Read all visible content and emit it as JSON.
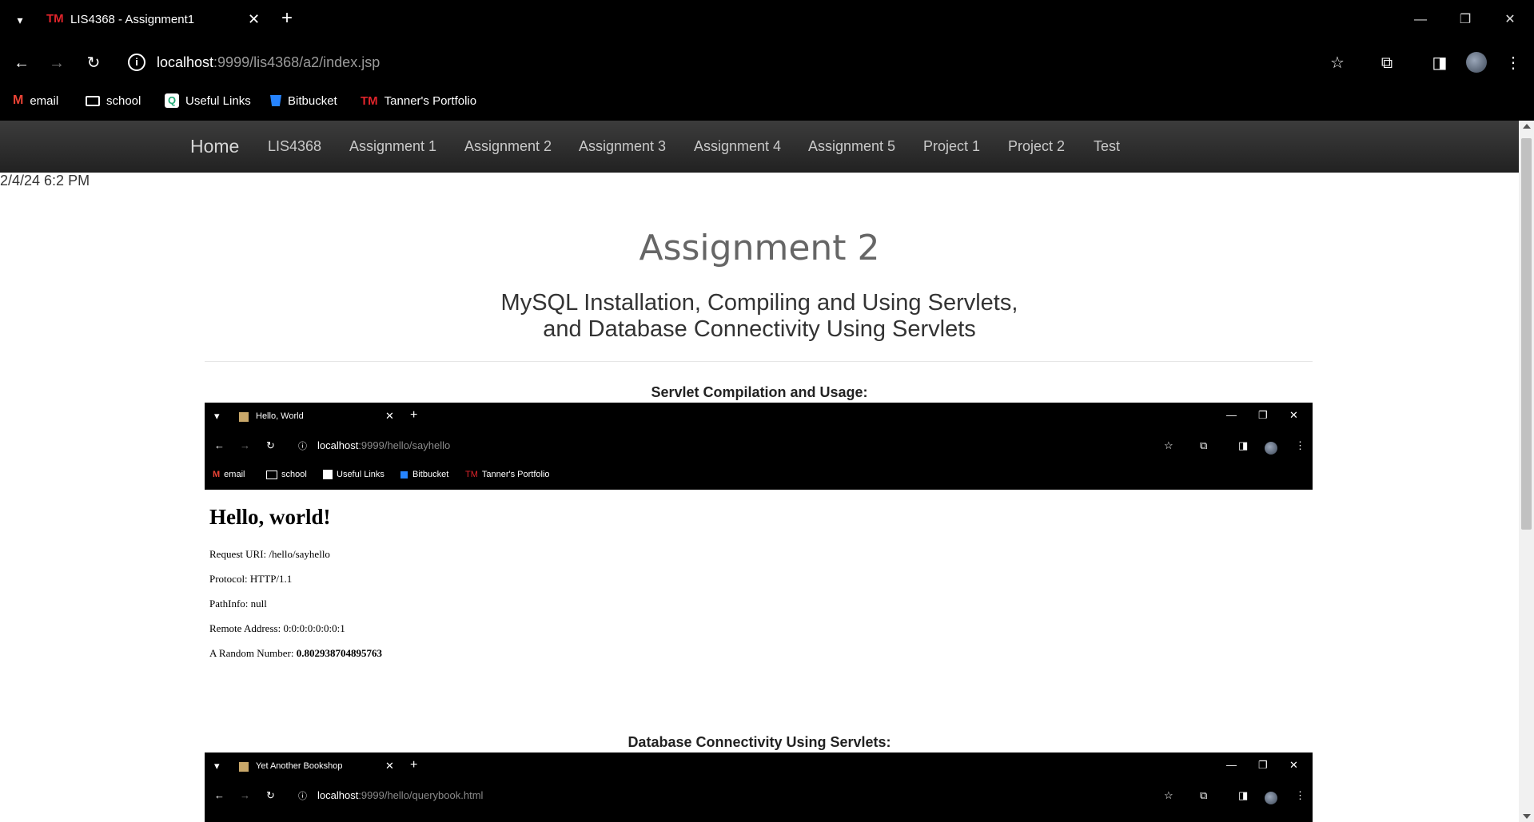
{
  "browser": {
    "tab": {
      "favicon_text": "TM",
      "title": "LIS4368 - Assignment1"
    },
    "url_host": "localhost",
    "url_rest": ":9999/lis4368/a2/index.jsp",
    "bookmarks": [
      {
        "icon": "gmail-icon",
        "label": "email"
      },
      {
        "icon": "folder-icon",
        "label": "school"
      },
      {
        "icon": "quick-links-icon",
        "label": "Useful Links"
      },
      {
        "icon": "bitbucket-icon",
        "label": "Bitbucket"
      },
      {
        "icon": "tm-logo-icon",
        "icon_text": "TM",
        "label": "Tanner's Portfolio"
      }
    ]
  },
  "navbar": {
    "brand": "Home",
    "items": [
      "LIS4368",
      "Assignment 1",
      "Assignment 2",
      "Assignment 3",
      "Assignment 4",
      "Assignment 5",
      "Project 1",
      "Project 2",
      "Test"
    ]
  },
  "page": {
    "timestamp": "2/4/24 6:2 PM",
    "title": "Assignment 2",
    "subtitle_line1": "MySQL Installation, Compiling and Using Servlets,",
    "subtitle_line2": "and Database Connectivity Using Servlets"
  },
  "screenshot1": {
    "caption": "Servlet Compilation and Usage:",
    "tab_title": "Hello, World",
    "url_host": "localhost",
    "url_rest": ":9999/hello/sayhello",
    "bookmarks": [
      {
        "icon": "gmail-icon",
        "label": "email"
      },
      {
        "icon": "folder-icon",
        "label": "school"
      },
      {
        "icon": "quick-links-icon",
        "label": "Useful Links"
      },
      {
        "icon": "bitbucket-icon",
        "label": "Bitbucket"
      },
      {
        "icon": "tm-logo-icon",
        "icon_text": "TM",
        "label": "Tanner's Portfolio"
      }
    ],
    "heading": "Hello, world!",
    "lines": [
      {
        "label": "Request URI: ",
        "value": "/hello/sayhello"
      },
      {
        "label": "Protocol: ",
        "value": "HTTP/1.1"
      },
      {
        "label": "PathInfo: ",
        "value": "null"
      },
      {
        "label": "Remote Address: ",
        "value": "0:0:0:0:0:0:0:1"
      }
    ],
    "random_label": "A Random Number: ",
    "random_value": "0.802938704895763"
  },
  "screenshot2": {
    "caption": "Database Connectivity Using Servlets:",
    "tab_title": "Yet Another Bookshop",
    "url_host": "localhost",
    "url_rest": ":9999/hello/querybook.html"
  }
}
